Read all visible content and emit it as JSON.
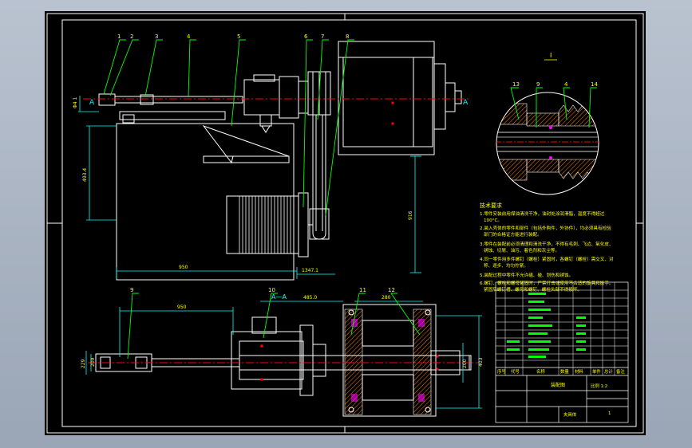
{
  "colors": {
    "background": "#000000",
    "frame": "#ffffff",
    "body": "#ffffff",
    "leader": "#00ff00",
    "dimension": "#00ffff",
    "center": "#ff0000",
    "hatch": "#ff7f00",
    "magenta": "#ff00ff",
    "text": "#ffff00"
  },
  "balloons": {
    "top": [
      "1",
      "2",
      "3",
      "4",
      "5",
      "6",
      "7",
      "8"
    ],
    "bottom": [
      "9",
      "10",
      "11",
      "12"
    ],
    "detail": [
      "13",
      "9",
      "4",
      "14"
    ]
  },
  "section_marks": {
    "left": "A",
    "right": "A",
    "title": "A—A",
    "detail": "I"
  },
  "dimensions": {
    "d_top_left": "Φ4 1",
    "d_height_left": "493.4",
    "d_width_top": "950",
    "d_width_top2": "1347.1",
    "d_height_right": "916",
    "d_width_bottom": "950",
    "d_mid": "485.0",
    "d_spindle": "280",
    "d_left_a": "229",
    "d_left_b": "209",
    "d_right_a": "200",
    "d_right_b": "403"
  },
  "tech_requirements": {
    "title": "技术要求",
    "lines": [
      "1.零件安装前用煤油清洗干净，油封处涂润滑脂，温度不得超过",
      "100°C。",
      "2.装入壳体的零件和部件（包括外购件，外协件），均必须具有检验",
      "部门的合格证方能进行装配。",
      "3.零件在装配前必须清理和清洗干净，不得有毛刺、飞边、氧化皮、",
      "锈蚀、切屑、油污、着色剂和灰尘等。",
      "4.同一零件用多件螺钉（螺栓）紧固时，各螺钉（螺栓）需交叉、对",
      "称、逐步、均匀拧紧。",
      "5.装配过程中零件不允许磕、碰、划伤和锈蚀。",
      "6.螺钉、螺栓和螺母紧固时，严禁打击或使用不合适的旋具和扳手。",
      "紧固后螺钉槽、螺母和螺钉、螺栓头部不得损坏。"
    ]
  },
  "title_block": {
    "header": [
      "序号",
      "代号",
      "名称",
      "数量",
      "材料",
      "单件",
      "总计",
      "备注"
    ],
    "center_title": "装配图",
    "scale": "比例 1:2",
    "company": "夹具体",
    "sheet": "1"
  }
}
